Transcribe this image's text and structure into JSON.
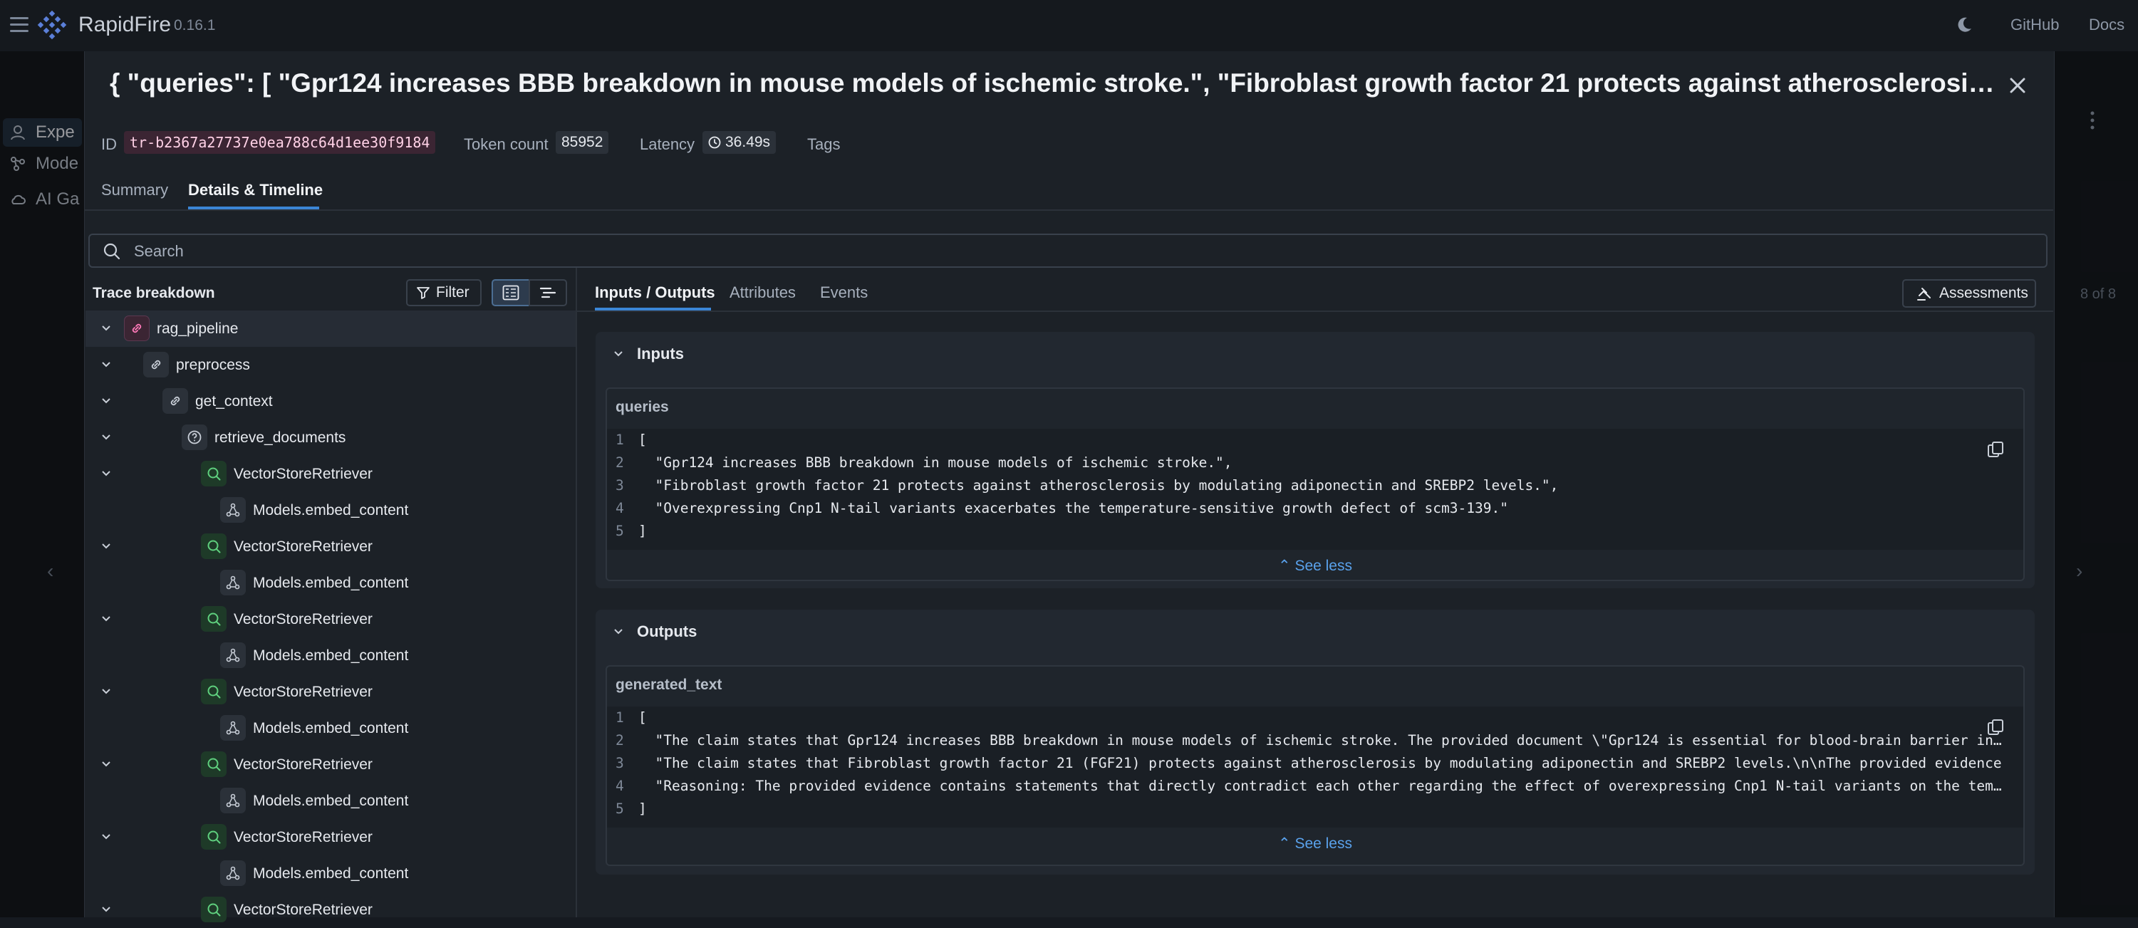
{
  "app": {
    "brand": "RapidFire",
    "version": "0.16.1",
    "links": [
      "GitHub",
      "Docs"
    ]
  },
  "background": {
    "sidebar": [
      "Expe",
      "Mode",
      "AI Ga"
    ],
    "right_text": "8 of 8"
  },
  "modal": {
    "title": "{ \"queries\": [ \"Gpr124 increases BBB breakdown in mouse models of ischemic stroke.\", \"Fibroblast growth factor 21 protects against atherosclerosis by modulating adiponectin and SREBP2 levels.\", \"Overexpressing Cnp1 N-tail variants exacerbates the temperature-sensitive growth defect of scm3-139.\" ] }",
    "meta": {
      "id_label": "ID",
      "id_value": "tr-b2367a27737e0ea788c64d1ee30f9184",
      "token_label": "Token count",
      "token_value": "85952",
      "latency_label": "Latency",
      "latency_value": "36.49s",
      "tags_label": "Tags"
    },
    "tabs": [
      "Summary",
      "Details & Timeline"
    ],
    "search_placeholder": "Search"
  },
  "trace": {
    "title": "Trace breakdown",
    "filter_label": "Filter",
    "nodes": [
      {
        "label": "rag_pipeline",
        "depth": 0,
        "icon": "link-icon"
      },
      {
        "label": "preprocess",
        "depth": 1,
        "icon": "link-icon"
      },
      {
        "label": "get_context",
        "depth": 2,
        "icon": "link-icon"
      },
      {
        "label": "retrieve_documents",
        "depth": 3,
        "icon": "question-icon"
      },
      {
        "label": "VectorStoreRetriever",
        "depth": 4,
        "icon": "search-icon"
      },
      {
        "label": "Models.embed_content",
        "depth": 5,
        "icon": "embedding-icon"
      },
      {
        "label": "VectorStoreRetriever",
        "depth": 4,
        "icon": "search-icon"
      },
      {
        "label": "Models.embed_content",
        "depth": 5,
        "icon": "embedding-icon"
      },
      {
        "label": "VectorStoreRetriever",
        "depth": 4,
        "icon": "search-icon"
      },
      {
        "label": "Models.embed_content",
        "depth": 5,
        "icon": "embedding-icon"
      },
      {
        "label": "VectorStoreRetriever",
        "depth": 4,
        "icon": "search-icon"
      },
      {
        "label": "Models.embed_content",
        "depth": 5,
        "icon": "embedding-icon"
      },
      {
        "label": "VectorStoreRetriever",
        "depth": 4,
        "icon": "search-icon"
      },
      {
        "label": "Models.embed_content",
        "depth": 5,
        "icon": "embedding-icon"
      },
      {
        "label": "VectorStoreRetriever",
        "depth": 4,
        "icon": "search-icon"
      },
      {
        "label": "Models.embed_content",
        "depth": 5,
        "icon": "embedding-icon"
      },
      {
        "label": "VectorStoreRetriever",
        "depth": 4,
        "icon": "search-icon"
      }
    ]
  },
  "detail": {
    "tabs": [
      "Inputs / Outputs",
      "Attributes",
      "Events"
    ],
    "assessments_label": "Assessments",
    "inputs": {
      "title": "Inputs",
      "field": "queries",
      "lines": [
        "[",
        "  \"Gpr124 increases BBB breakdown in mouse models of ischemic stroke.\",",
        "  \"Fibroblast growth factor 21 protects against atherosclerosis by modulating adiponectin and SREBP2 levels.\",",
        "  \"Overexpressing Cnp1 N-tail variants exacerbates the temperature-sensitive growth defect of scm3-139.\"",
        "]"
      ],
      "see_less": "See less"
    },
    "outputs": {
      "title": "Outputs",
      "field": "generated_text",
      "lines": [
        "[",
        "  \"The claim states that Gpr124 increases BBB breakdown in mouse models of ischemic stroke. The provided document \\\"Gpr124 is essential for blood-brain barrier integrity\\\"",
        "  \"The claim states that Fibroblast growth factor 21 (FGF21) protects against atherosclerosis by modulating adiponectin and SREBP2 levels.\\n\\nThe provided evidence",
        "  \"Reasoning: The provided evidence contains statements that directly contradict each other regarding the effect of overexpressing Cnp1 N-tail variants on the temperature",
        "]"
      ],
      "see_less": "See less"
    }
  }
}
